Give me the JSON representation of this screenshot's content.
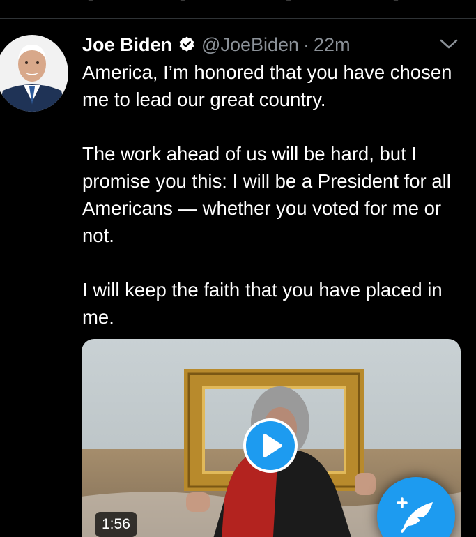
{
  "tweet": {
    "author_name": "Joe Biden",
    "handle": "@JoeBiden",
    "separator": "·",
    "time_ago": "22m",
    "paragraphs": [
      "America, I’m honored that you have chosen me to lead our great country.",
      "The work ahead of us will be hard, but I promise you this: I will be a President for all Americans — whether you voted for me or not.",
      "I will keep the faith that you have placed in me."
    ],
    "video_duration": "1:56"
  },
  "colors": {
    "background": "#000000",
    "accent": "#1d9bf0",
    "muted_text": "#8b9198",
    "primary_text": "#ffffff"
  },
  "icons": {
    "verified": "verified-badge-icon",
    "menu": "chevron-down-icon",
    "play": "play-icon",
    "compose": "compose-feather-icon"
  }
}
